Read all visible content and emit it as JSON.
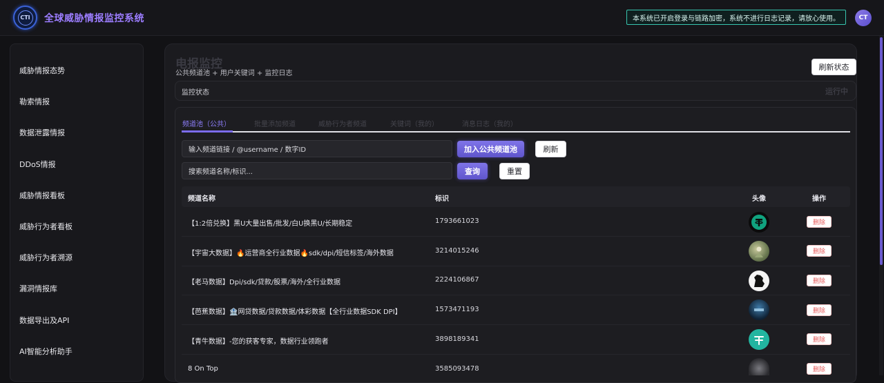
{
  "header": {
    "logo_text": "CTI",
    "app_title": "全球威胁情报监控系统",
    "notice": "本系统已开启登录与链路加密，系统不进行日志记录，请放心使用。",
    "user_initials": "CT"
  },
  "sidebar": {
    "items": [
      {
        "label": "威胁情报态势"
      },
      {
        "label": "勒索情报"
      },
      {
        "label": "数据泄露情报"
      },
      {
        "label": "DDoS情报"
      },
      {
        "label": "威胁情报看板"
      },
      {
        "label": "威胁行为者看板"
      },
      {
        "label": "威胁行为者溯源"
      },
      {
        "label": "漏洞情报库"
      },
      {
        "label": "数据导出及API"
      },
      {
        "label": "AI智能分析助手"
      }
    ]
  },
  "page": {
    "title": "电报监控",
    "subtitle": "公共频道池 + 用户关键词 + 监控日志",
    "refresh_status_label": "刷新状态",
    "status_label": "监控状态",
    "status_value": "运行中"
  },
  "tabs": [
    {
      "label": "频道池（公共）",
      "active": true
    },
    {
      "label": "批量添加频道",
      "active": false
    },
    {
      "label": "威胁行为者频道",
      "active": false
    },
    {
      "label": "关键词（我的）",
      "active": false
    },
    {
      "label": "消息日志（我的）",
      "active": false
    }
  ],
  "form": {
    "channel_input_placeholder": "输入频道链接 / @username / 数字ID",
    "add_button": "加入公共频道池",
    "refresh_button": "刷新",
    "search_placeholder": "搜索频道名称/标识...",
    "query_button": "查询",
    "reset_button": "重置"
  },
  "table": {
    "columns": {
      "name": "频道名称",
      "id": "标识",
      "avatar": "头像",
      "action": "操作"
    },
    "delete_label": "删除",
    "rows": [
      {
        "name": "【1:2倍兑换】黑U大量出售/批发/白U换黑U/长期稳定",
        "id": "1793661023",
        "emoji": "",
        "avatar_color": "#10a37f"
      },
      {
        "name": "【宇宙大数据】🔥运营商全行业数据🔥sdk/dpi/短信标签/海外数据",
        "id": "3214015246",
        "emoji": "",
        "avatar_color": "#8a9a6a"
      },
      {
        "name": "【老马数据】Dpi/sdk/贷款/股票/海外/全行业数据",
        "id": "2224106867",
        "emoji": "",
        "avatar_color": "#f2f2f2"
      },
      {
        "name": "【芭蕉数据】🏦网贷数据/贷款数据/体彩数据【全行业数据SDK DPI】",
        "id": "1573471193",
        "emoji": "",
        "avatar_color": "#1c3a5a"
      },
      {
        "name": "【青牛数据】-您的获客专家，数据行业领跑者",
        "id": "3898189341",
        "emoji": "",
        "avatar_color": "#22b5a0"
      },
      {
        "name": "8 On Top",
        "id": "3585093478",
        "emoji": "",
        "avatar_color": "#5a5a60"
      }
    ]
  },
  "colors": {
    "accent": "#7c6cf0",
    "notice_border": "#38c6b0",
    "delete_text": "#e65c5c"
  }
}
